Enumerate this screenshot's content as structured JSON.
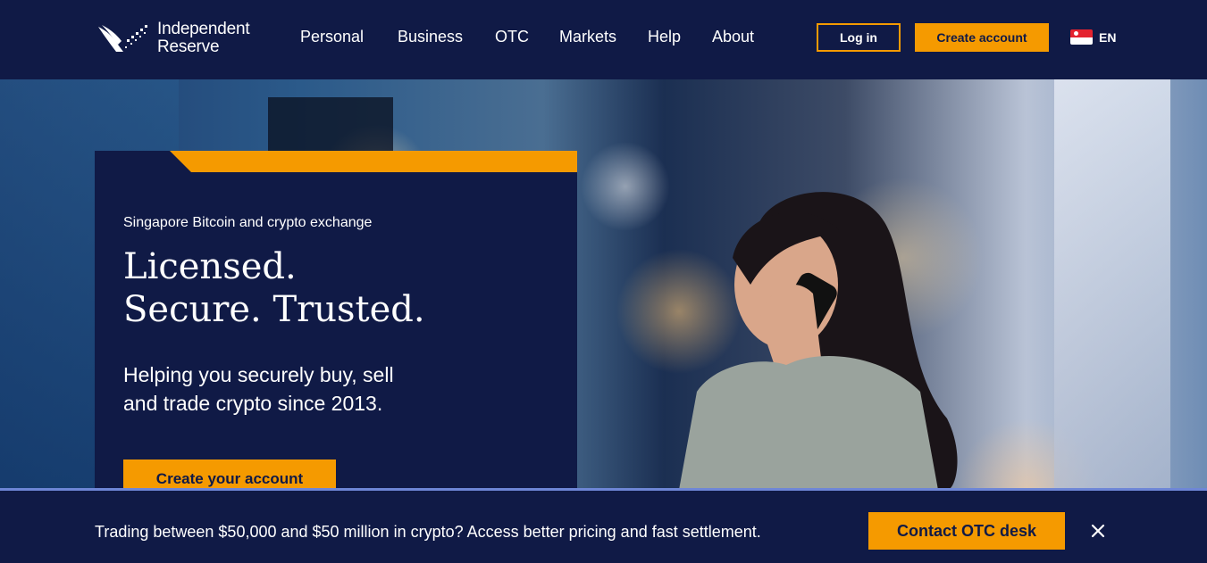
{
  "header": {
    "logo_line1": "Independent",
    "logo_line2": "Reserve",
    "nav": [
      "Personal",
      "Business",
      "OTC",
      "Markets",
      "Help",
      "About"
    ],
    "login_label": "Log in",
    "create_label": "Create account",
    "language": "EN",
    "flag": "singapore-flag-icon"
  },
  "hero": {
    "subtitle": "Singapore Bitcoin and crypto exchange",
    "title_line1": "Licensed.",
    "title_line2": "Secure. Trusted.",
    "desc_line1": "Helping you securely buy, sell",
    "desc_line2": "and trade crypto since 2013.",
    "cta_label": "Create your account"
  },
  "banner": {
    "text": "Trading between $50,000 and $50 million in crypto? Access better pricing and fast settlement.",
    "cta_label": "Contact OTC desk",
    "close_icon": "close-icon"
  },
  "colors": {
    "navy": "#101a46",
    "accent": "#f59a00",
    "banner_border": "#6e86d6"
  }
}
